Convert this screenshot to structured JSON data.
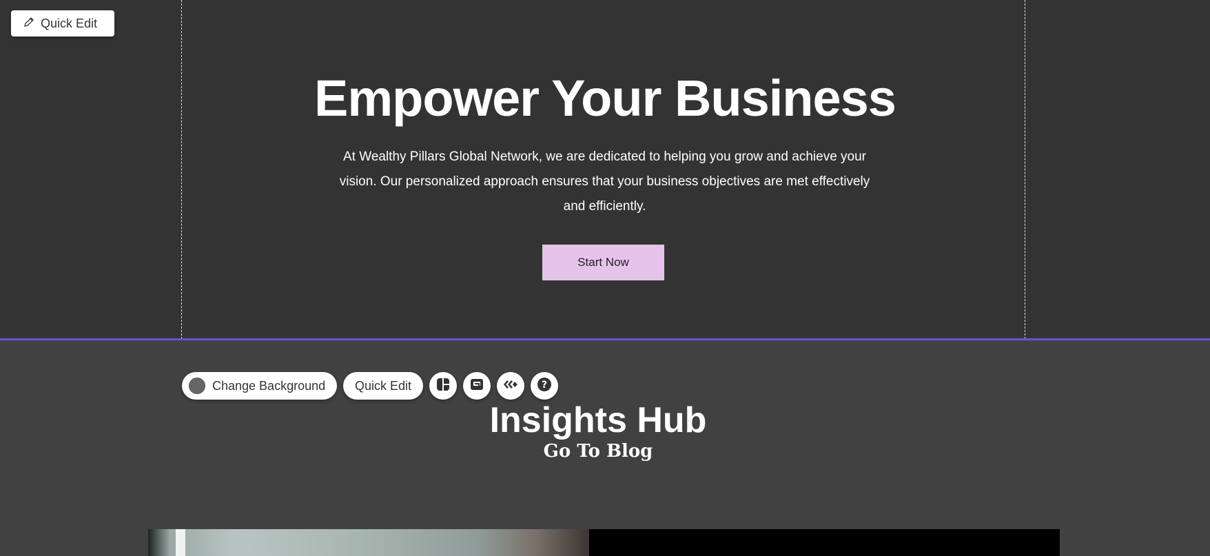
{
  "editor": {
    "quick_edit_top": "Quick Edit",
    "section_toolbar": {
      "change_background": "Change Background",
      "quick_edit": "Quick Edit",
      "icons": [
        "layout-icon",
        "move-icon",
        "animation-icon",
        "help-icon"
      ]
    }
  },
  "hero": {
    "title": "Empower Your Business",
    "text": "At Wealthy Pillars Global Network, we are dedicated to helping you grow and achieve your vision. Our personalized approach ensures that your business objectives are met effectively and efficiently.",
    "button": "Start Now"
  },
  "insights": {
    "title": "Insights Hub",
    "link": "Go To Blog"
  },
  "colors": {
    "background": "#333333",
    "section_background": "#414141",
    "accent_button": "#e6c3ea",
    "selection_line": "#6b53d8"
  }
}
